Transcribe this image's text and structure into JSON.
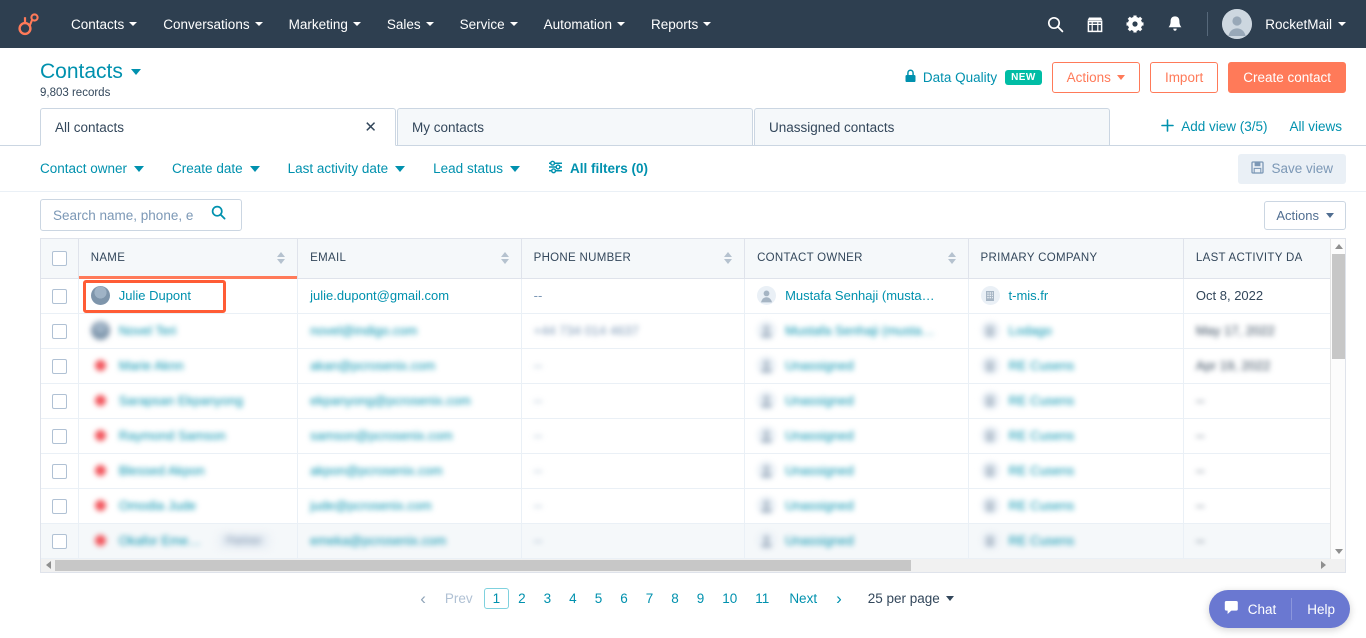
{
  "topnav": {
    "logo_icon": "hubspot-sprocket-logo",
    "items": [
      {
        "label": "Contacts"
      },
      {
        "label": "Conversations"
      },
      {
        "label": "Marketing"
      },
      {
        "label": "Sales"
      },
      {
        "label": "Service"
      },
      {
        "label": "Automation"
      },
      {
        "label": "Reports"
      }
    ],
    "icons": [
      "search-icon",
      "marketplace-icon",
      "settings-gear-icon",
      "notifications-bell-icon"
    ],
    "account_name": "RocketMail"
  },
  "page": {
    "title": "Contacts",
    "record_count": "9,803 records",
    "data_quality": {
      "label": "Data Quality",
      "badge": "NEW",
      "icon": "lock-icon"
    },
    "actions_label": "Actions",
    "import_label": "Import",
    "create_label": "Create contact"
  },
  "tabs": {
    "items": [
      {
        "label": "All contacts",
        "active": true,
        "closable": true
      },
      {
        "label": "My contacts",
        "active": false,
        "closable": false
      },
      {
        "label": "Unassigned contacts",
        "active": false,
        "closable": false
      }
    ],
    "add_view_label": "Add view (3/5)",
    "all_views_label": "All views"
  },
  "filters": {
    "items": [
      {
        "label": "Contact owner"
      },
      {
        "label": "Create date"
      },
      {
        "label": "Last activity date"
      },
      {
        "label": "Lead status"
      }
    ],
    "all_filters_label": "All filters (0)",
    "save_view_label": "Save view"
  },
  "search": {
    "placeholder": "Search name, phone, e",
    "value": "",
    "icon": "search-icon"
  },
  "table_actions_label": "Actions",
  "table": {
    "columns": [
      {
        "label": "NAME",
        "sortable": true,
        "active_sort": true
      },
      {
        "label": "EMAIL",
        "sortable": true
      },
      {
        "label": "PHONE NUMBER",
        "sortable": true
      },
      {
        "label": "CONTACT OWNER",
        "sortable": true
      },
      {
        "label": "PRIMARY COMPANY",
        "sortable": false
      },
      {
        "label": "LAST ACTIVITY DA",
        "sortable": false
      }
    ],
    "rows": [
      {
        "name": "Julie Dupont",
        "email": "julie.dupont@gmail.com",
        "phone": "--",
        "owner": "Mustafa Senhaji (musta…",
        "company": "t-mis.fr",
        "last_activity": "Oct 8, 2022",
        "redacted": false,
        "highlighted": true,
        "avatar": "photo"
      },
      {
        "name": "Novel Teri",
        "email": "novel@indigo.com",
        "phone": "+44 734 014 4637",
        "owner": "Mustafa Senhaji (musta…",
        "company": "Lodago",
        "last_activity": "May 17, 2022",
        "redacted": true,
        "avatar": "photo"
      },
      {
        "name": "Marie Aknn",
        "email": "akan@pcrosenix.com",
        "phone": "--",
        "owner": "Unassigned",
        "company": "RE Cusens",
        "last_activity": "Apr 19, 2022",
        "redacted": true,
        "avatar": "red"
      },
      {
        "name": "Sarapsan Ekpanyong",
        "email": "ekpanyong@pcrosenix.com",
        "phone": "--",
        "owner": "Unassigned",
        "company": "RE Cusens",
        "last_activity": "--",
        "redacted": true,
        "avatar": "red"
      },
      {
        "name": "Raymond Samson",
        "email": "samson@pcrosenix.com",
        "phone": "--",
        "owner": "Unassigned",
        "company": "RE Cusens",
        "last_activity": "--",
        "redacted": true,
        "avatar": "red"
      },
      {
        "name": "Blessed Akpon",
        "email": "akpon@pcrosenix.com",
        "phone": "--",
        "owner": "Unassigned",
        "company": "RE Cusens",
        "last_activity": "--",
        "redacted": true,
        "avatar": "red"
      },
      {
        "name": "Omodia Jude",
        "email": "jude@pcrosenix.com",
        "phone": "--",
        "owner": "Unassigned",
        "company": "RE Cusens",
        "last_activity": "--",
        "redacted": true,
        "avatar": "red"
      },
      {
        "name": "Okafor Eme…",
        "badge": "Partner",
        "email": "emeka@pcrosenix.com",
        "phone": "--",
        "owner": "Unassigned",
        "company": "RE Cusens",
        "last_activity": "--",
        "redacted": true,
        "hovered": true,
        "avatar": "red"
      }
    ]
  },
  "pagination": {
    "prev_label": "Prev",
    "next_label": "Next",
    "pages": [
      "1",
      "2",
      "3",
      "4",
      "5",
      "6",
      "7",
      "8",
      "9",
      "10",
      "11"
    ],
    "current_page": "1",
    "per_page_label": "25 per page"
  },
  "chat_widget": {
    "chat_label": "Chat",
    "help_label": "Help",
    "icon": "chat-bubble-icon"
  },
  "colors": {
    "brand_orange": "#ff7a59",
    "highlight_orange": "#ff5c35",
    "teal_link": "#0091ae",
    "nav_dark": "#2e3f50",
    "badge_green": "#00bda5",
    "chat_purple": "#6a78d1"
  }
}
